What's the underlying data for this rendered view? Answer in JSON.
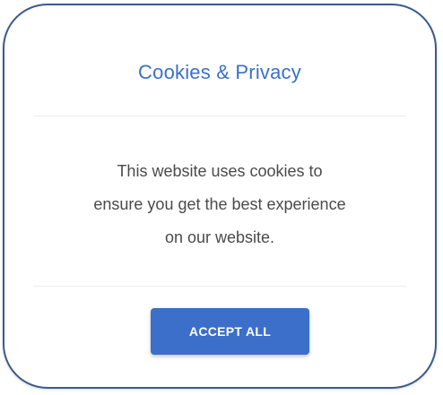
{
  "dialog": {
    "title": "Cookies & Privacy",
    "message_lines": [
      "This website uses cookies to",
      "ensure you get the best experience",
      "on our website."
    ],
    "accept_label": "ACCEPT ALL"
  },
  "colors": {
    "accent": "#3b6fc9",
    "border": "#3c5a8c",
    "text": "#4a4a4a",
    "divider": "#ececec"
  }
}
